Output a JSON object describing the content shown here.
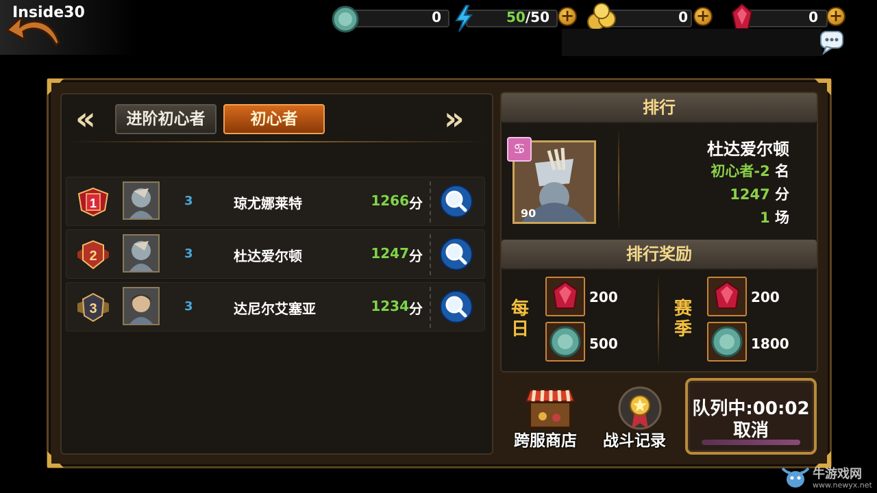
{
  "player": {
    "name": "Inside30"
  },
  "resources": {
    "stone": {
      "value": "0"
    },
    "energy": {
      "current": "50",
      "sep_max": "/50"
    },
    "gold": {
      "value": "0"
    },
    "gem": {
      "value": "0"
    }
  },
  "tabs": {
    "advanced": "进阶初心者",
    "beginner": "初心者",
    "active": "beginner"
  },
  "leaderboard": [
    {
      "rank": "1",
      "level": "3",
      "name": "琼尤娜莱特",
      "score": "1266",
      "unit": "分"
    },
    {
      "rank": "2",
      "level": "3",
      "name": "杜达爱尔顿",
      "score": "1247",
      "unit": "分"
    },
    {
      "rank": "3",
      "level": "3",
      "name": "达尼尔艾塞亚",
      "score": "1234",
      "unit": "分"
    }
  ],
  "ranking": {
    "title": "排行",
    "portrait_level": "90",
    "name": "杜达爱尔顿",
    "tier_rank": "初心者-2",
    "tier_suffix": " 名",
    "score": "1247",
    "score_unit": " 分",
    "matches": "1",
    "matches_unit": " 场"
  },
  "rewards": {
    "title": "排行奖励",
    "daily_label": "每日",
    "season_label": "赛季",
    "daily": [
      {
        "item": "gem",
        "amount": "200"
      },
      {
        "item": "stone",
        "amount": "500"
      }
    ],
    "season": [
      {
        "item": "gem",
        "amount": "200"
      },
      {
        "item": "stone",
        "amount": "1800"
      }
    ]
  },
  "actions": {
    "shop": "跨服商店",
    "battle_log": "战斗记录",
    "queue": "队列中:00:02",
    "cancel": "取消"
  },
  "watermark": {
    "text": "牛游戏网",
    "url": "www.newyx.net"
  },
  "colors": {
    "score_green": "#7ed64a",
    "accent_orange": "#d66a1c",
    "gold": "#f4d98a"
  }
}
